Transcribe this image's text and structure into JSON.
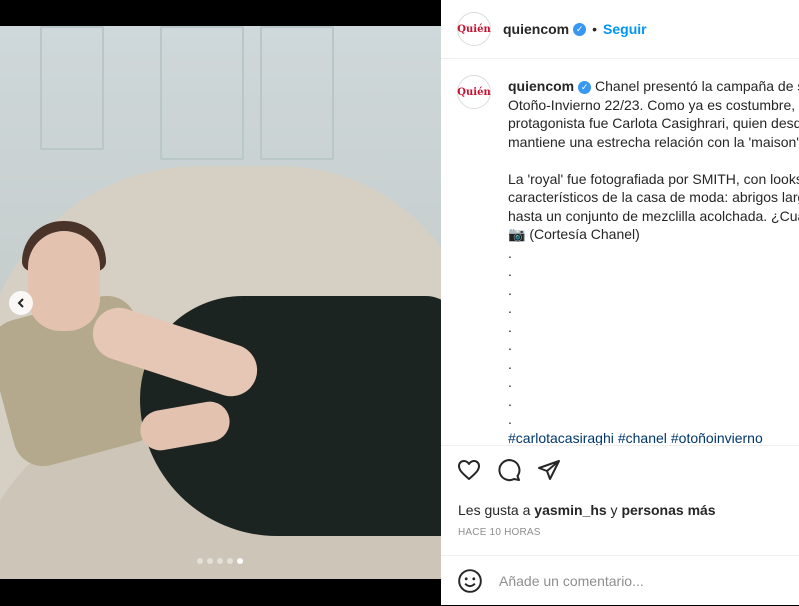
{
  "post": {
    "username": "quiencom",
    "follow_label": "Seguir",
    "separator": "•",
    "avatar_text": "Quién"
  },
  "caption": {
    "lines": [
      "Chanel presentó la campaña de su",
      "Otoño-Invierno 22/23. Como ya es costumbre,",
      "protagonista fue Carlota Casighrari, quien desd",
      "mantiene una estrecha relación con la 'maison'.",
      "",
      "La 'royal' fue fotografiada por SMITH, con looks",
      "característicos de la casa de moda: abrigos larg",
      "hasta un conjunto de mezclilla acolchada. ¿Cuá",
      "📷 (Cortesía Chanel)",
      ".",
      ".",
      ".",
      ".",
      ".",
      ".",
      ".",
      ".",
      ".",
      "."
    ],
    "hashtags": [
      "#carlotacasiraghi",
      "#chanel",
      "#otoñoinvierno"
    ]
  },
  "likes": {
    "prefix": "Les gusta a",
    "user": "yasmin_hs",
    "connector": "y",
    "others": "personas más"
  },
  "timestamp": "HACE 10 HORAS",
  "comment": {
    "placeholder": "Añade un comentario..."
  },
  "carousel": {
    "slide_count": 5,
    "active_index": 4
  },
  "icons": {
    "prev": "chevron-left-icon",
    "like": "heart-icon",
    "comment": "comment-icon",
    "share": "paper-plane-icon",
    "emoji": "emoji-icon",
    "verified": "verified-badge-icon"
  },
  "colors": {
    "accent": "#0095f6",
    "verified": "#3897f0",
    "hashtag": "#00376b",
    "brand": "#c8102e"
  }
}
